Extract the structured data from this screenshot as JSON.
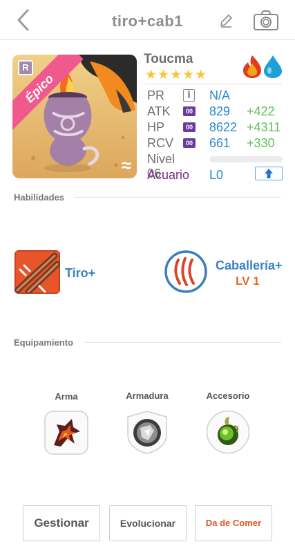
{
  "header": {
    "title": "tiro+cab1"
  },
  "unit": {
    "name": "Toucma",
    "stars": "★★★★★",
    "star_count": 5,
    "rarity": "Épico",
    "rank_badge": "R",
    "elements": [
      "fire",
      "water"
    ],
    "class_mark": "≈"
  },
  "stats": {
    "pr": {
      "label": "PR",
      "icon": "i",
      "value": "N/A"
    },
    "atk": {
      "label": "ATK",
      "icon": "00",
      "value": "829",
      "bonus": "+422"
    },
    "hp": {
      "label": "HP",
      "icon": "00",
      "value": "8622",
      "bonus": "+4311"
    },
    "rcv": {
      "label": "RCV",
      "icon": "00",
      "value": "661",
      "bonus": "+330"
    },
    "level": {
      "label": "Nivel 06",
      "progress": 0
    },
    "sign": {
      "label": "Acuario",
      "value": "L0"
    }
  },
  "abilities": {
    "section_label": "Habilidades",
    "skill1": {
      "name": "Tiro+"
    },
    "skill2": {
      "name": "Caballería+",
      "level": "LV 1"
    }
  },
  "equipment": {
    "section_label": "Equipamiento",
    "slots": [
      {
        "label": "Arma"
      },
      {
        "label": "Armadura"
      },
      {
        "label": "Accesorio"
      }
    ]
  },
  "actions": {
    "manage": "Gestionar",
    "evolve": "Evolucionar",
    "feed": "Da de Comer"
  },
  "colors": {
    "value_blue": "#2a87d3",
    "bonus_green": "#62c05a",
    "sign_purple": "#7a2a8a",
    "feed_orange": "#e0531f",
    "rarity_pink": "#f0598e"
  }
}
